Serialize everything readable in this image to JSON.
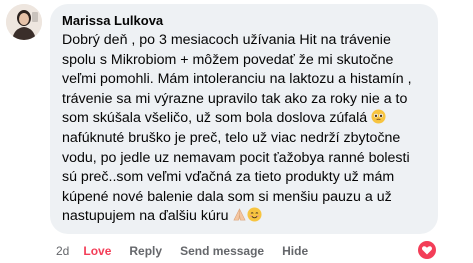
{
  "comment": {
    "author": "Marissa Lulkova",
    "lines": [
      "Dobrý deň , po 3 mesiacoch užívania Hit na trávenie",
      "spolu s Mikrobiom + môžem povedať že mi skutočne",
      "veľmi pomohli. Mám intoleranciu na laktozu a histamín ,",
      "trávenie sa mi výrazne upravilo tak ako za roky nie a to",
      "som skúšala všeličo, už som bola doslova zúfalá",
      "nafúknuté bruško je preč, telo už viac nedrží zbytočne",
      "vodu, po jedle uz nemavam pocit ťažobya ranné bolesti",
      "sú preč..som veľmi vďačná za tieto produkty už mám",
      "kúpené nové balenie dala som si menšiu pauzu a už",
      "nastupujem na ďalšiu kúru"
    ],
    "emojis": {
      "line5": "pleading-face",
      "line10": [
        "folded-hands",
        "smiling-face"
      ]
    }
  },
  "actions": {
    "time": "2d",
    "love": "Love",
    "reply": "Reply",
    "send_message": "Send message",
    "hide": "Hide"
  },
  "reaction": {
    "icon": "love-reaction-icon",
    "color": "#f33e58"
  }
}
